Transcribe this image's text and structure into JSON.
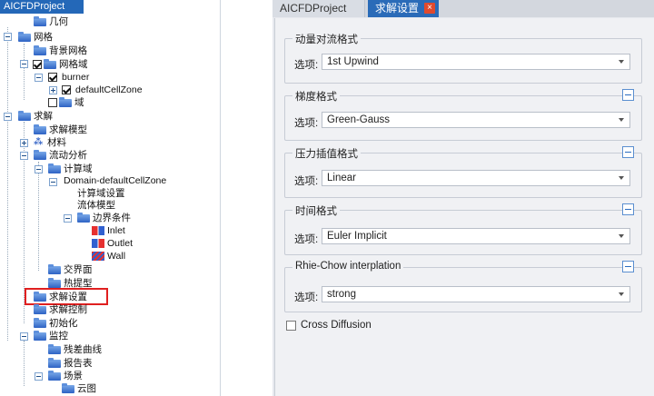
{
  "project_tree": {
    "title": "AICFDProject",
    "items": [
      {
        "label": "几何",
        "checked": null
      },
      {
        "label": "网格",
        "checked": null
      },
      {
        "label": "背景网格",
        "checked": null
      },
      {
        "label": "网格域",
        "checked": true
      },
      {
        "label": "burner",
        "checked": true
      },
      {
        "label": "defaultCellZone",
        "checked": true
      },
      {
        "label": "域",
        "checked": false
      },
      {
        "label": "求解",
        "checked": null
      },
      {
        "label": "求解模型",
        "checked": null
      },
      {
        "label": "材料",
        "checked": null
      },
      {
        "label": "流动分析",
        "checked": null
      },
      {
        "label": "计算域",
        "checked": null
      },
      {
        "label": "Domain-defaultCellZone",
        "checked": null
      },
      {
        "label": "计算域设置",
        "checked": null
      },
      {
        "label": "流体模型",
        "checked": null
      },
      {
        "label": "边界条件",
        "checked": null
      },
      {
        "label": "Inlet",
        "checked": null
      },
      {
        "label": "Outlet",
        "checked": null
      },
      {
        "label": "Wall",
        "checked": null
      },
      {
        "label": "交界面",
        "checked": null
      },
      {
        "label": "热提型",
        "checked": null
      },
      {
        "label": "求解设置",
        "checked": null
      },
      {
        "label": "求解控制",
        "checked": null
      },
      {
        "label": "初始化",
        "checked": null
      },
      {
        "label": "监控",
        "checked": null
      },
      {
        "label": "残差曲线",
        "checked": null
      },
      {
        "label": "报告表",
        "checked": null
      },
      {
        "label": "场景",
        "checked": null
      },
      {
        "label": "云图",
        "checked": null
      }
    ]
  },
  "tabs": {
    "project": "AICFDProject",
    "solver": "求解设置",
    "close_glyph": "×"
  },
  "settings": {
    "option_label": "选项:",
    "groups": [
      {
        "title": "动量对流格式",
        "value": "1st Upwind"
      },
      {
        "title": "梯度格式",
        "value": "Green-Gauss"
      },
      {
        "title": "压力插值格式",
        "value": "Linear"
      },
      {
        "title": "时间格式",
        "value": "Euler Implicit"
      },
      {
        "title": "Rhie-Chow interplation",
        "value": "strong"
      }
    ],
    "cross_diffusion": {
      "label": "Cross Diffusion",
      "checked": false
    }
  },
  "colors": {
    "accent": "#2a6bb8",
    "highlight_border": "#e02020",
    "tab_close": "#e04a2e"
  }
}
